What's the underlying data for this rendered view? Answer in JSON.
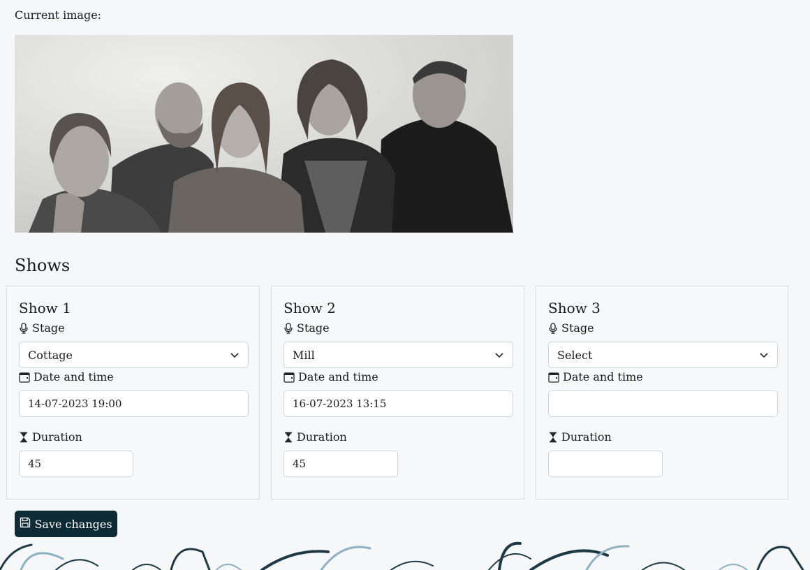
{
  "current_image": {
    "label": "Current image:"
  },
  "shows_heading": "Shows",
  "shows": [
    {
      "title": "Show 1",
      "stage_label": "Stage",
      "stage_value": "Cottage",
      "date_label": "Date and time",
      "date_value": "14-07-2023 19:00",
      "duration_label": "Duration",
      "duration_value": "45"
    },
    {
      "title": "Show 2",
      "stage_label": "Stage",
      "stage_value": "Mill",
      "date_label": "Date and time",
      "date_value": "16-07-2023 13:15",
      "duration_label": "Duration",
      "duration_value": "45"
    },
    {
      "title": "Show 3",
      "stage_label": "Stage",
      "stage_value": "Select",
      "date_label": "Date and time",
      "date_value": "",
      "duration_label": "Duration",
      "duration_value": ""
    }
  ],
  "save_button": {
    "label": "Save changes"
  },
  "colors": {
    "button_bg": "#0f2c36",
    "page_bg": "#f5f7f9",
    "card_border": "#d7dbdf"
  },
  "icons": {
    "stage": "microphone-icon",
    "date": "calendar-icon",
    "duration": "hourglass-icon",
    "select": "chevron-down-icon",
    "save": "floppy-disk-icon"
  }
}
